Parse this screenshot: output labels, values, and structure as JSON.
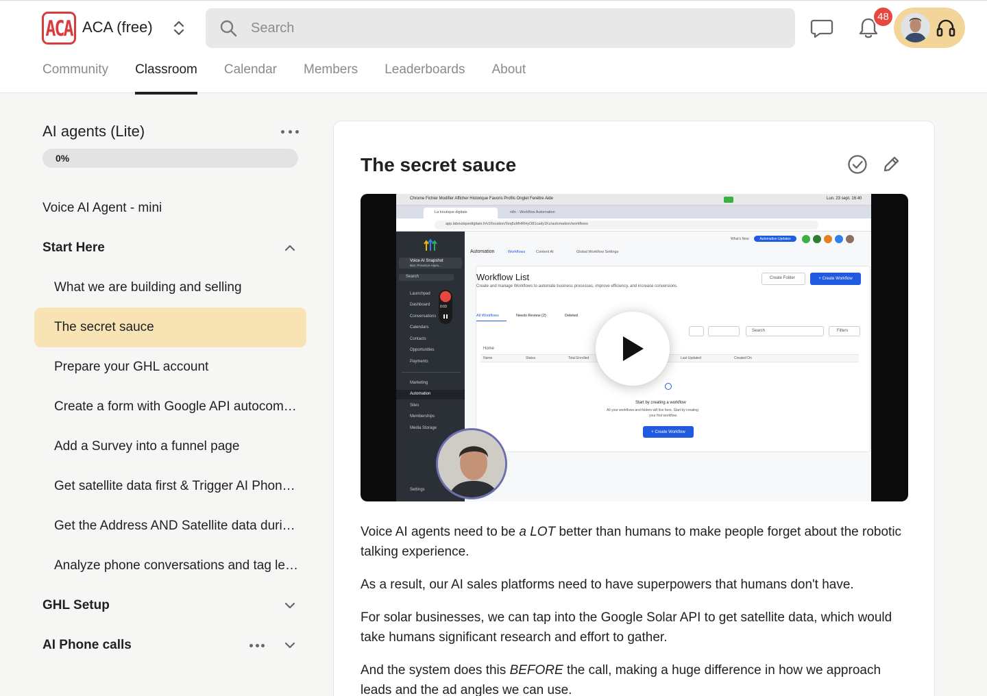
{
  "header": {
    "logo_text": "ACA",
    "group_name": "ACA (free)",
    "search_placeholder": "Search",
    "notification_count": "48",
    "accent_color": "#f3d59a",
    "logo_color": "#d93a3a"
  },
  "tabs": [
    {
      "label": "Community",
      "active": false
    },
    {
      "label": "Classroom",
      "active": true
    },
    {
      "label": "Calendar",
      "active": false
    },
    {
      "label": "Members",
      "active": false
    },
    {
      "label": "Leaderboards",
      "active": false
    },
    {
      "label": "About",
      "active": false
    }
  ],
  "sidebar": {
    "course_title": "AI agents (Lite)",
    "progress_label": "0%",
    "progress_fraction": 0,
    "items": [
      {
        "label": "Voice AI Agent - mini",
        "kind": "top"
      },
      {
        "label": "Start Here",
        "kind": "section",
        "expanded": true
      },
      {
        "label": "What we are building and selling",
        "kind": "lesson"
      },
      {
        "label": "The secret sauce",
        "kind": "lesson",
        "active": true
      },
      {
        "label": "Prepare your GHL account",
        "kind": "lesson"
      },
      {
        "label": "Create a form with Google API autocom…",
        "kind": "lesson"
      },
      {
        "label": "Add a Survey into a funnel page",
        "kind": "lesson"
      },
      {
        "label": "Get satellite data first & Trigger AI Phon…",
        "kind": "lesson"
      },
      {
        "label": "Get the Address AND Satellite data duri…",
        "kind": "lesson"
      },
      {
        "label": "Analyze phone conversations and tag le…",
        "kind": "lesson"
      },
      {
        "label": "GHL Setup",
        "kind": "section",
        "expanded": false
      },
      {
        "label": "AI Phone calls",
        "kind": "section",
        "expanded": false,
        "has_menu": true
      }
    ]
  },
  "lesson": {
    "title": "The secret sauce",
    "video": {
      "menu_bar": "Chrome   Fichier   Modifier   Afficher   Historique   Favoris   Profils   Onglet   Fenêtre   Aide",
      "clock": "Lun. 23 sept.  16:40",
      "tab1": "La boutique digitale",
      "tab2": "n8n - Workflow Automation",
      "url": "app.laboutiquedigitale.fr/v2/location/9zq5uMHRHyO81cady1Kz/automation/workflows",
      "account": "Voice AI Snapshot",
      "account_sub": "Biot, Provence-Alpes...",
      "side_search": "Search",
      "side_items": [
        "Launchpad",
        "Dashboard",
        "Conversations",
        "Calendars",
        "Contacts",
        "Opportunities",
        "Payments"
      ],
      "side_items2": [
        "Marketing",
        "Automation",
        "Sites",
        "Memberships",
        "Media Storage"
      ],
      "rec_time": "0:03",
      "whats_new": "What's New",
      "updates": "Automation Updates",
      "nav_items": [
        "Automation",
        "Workflows",
        "Content AI",
        "Global Workflow Settings"
      ],
      "list_title": "Workflow List",
      "list_desc": "Create and manage Workflows to automate business processes, improve efficiency, and increase conversions.",
      "create_folder": "Create Folder",
      "create_workflow": "+ Create Workflow",
      "subtabs": [
        "All Workflows",
        "Needs Review (2)",
        "Deleted"
      ],
      "search": "Search",
      "filters": "Filters",
      "home": "Home",
      "columns": [
        "Name",
        "Status",
        "Total Enrolled",
        "Last Updated",
        "Created On"
      ],
      "empty_title": "Start by creating a workflow",
      "empty_desc1": "All your workflows and folders will live here. Start by creating",
      "empty_desc2": "your first workflow.",
      "settings": "Settings"
    },
    "paragraphs": [
      {
        "before": "Voice AI agents need to be ",
        "em": "a LOT",
        "after": " better than humans to make people forget about the robotic talking experience."
      },
      {
        "before": "As a result, our AI sales platforms need to have superpowers that humans don't have.",
        "em": "",
        "after": ""
      },
      {
        "before": "For solar businesses, we can tap into the Google Solar API to get satellite data, which would take humans significant research and effort to gather.",
        "em": "",
        "after": ""
      },
      {
        "before": "And the system does this ",
        "em": "BEFORE",
        "after": "  the call, making a huge difference in how we approach leads and the ad angles we can use."
      }
    ]
  }
}
